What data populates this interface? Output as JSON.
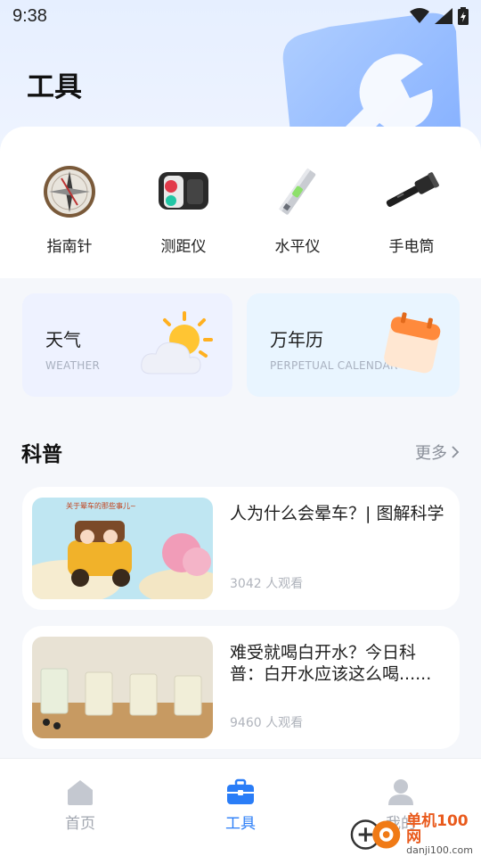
{
  "status_bar": {
    "time": "9:38"
  },
  "page": {
    "title": "工具"
  },
  "tools": [
    {
      "label": "指南针",
      "icon": "compass-icon"
    },
    {
      "label": "测距仪",
      "icon": "rangefinder-icon"
    },
    {
      "label": "水平仪",
      "icon": "level-icon"
    },
    {
      "label": "手电筒",
      "icon": "flashlight-icon"
    }
  ],
  "cards": {
    "weather": {
      "title": "天气",
      "subtitle": "WEATHER",
      "icon": "weather-cloud-sun-icon"
    },
    "calendar": {
      "title": "万年历",
      "subtitle": "PERPETUAL CALENDAR",
      "icon": "calendar-icon"
    }
  },
  "science": {
    "title": "科普",
    "more": "更多",
    "articles": [
      {
        "title": "人为什么会晕车？| 图解科学",
        "views": "3042 人观看",
        "thumb_caption": "关于晕车的那些事儿~"
      },
      {
        "title": "难受就喝白开水？今日科普：白开水应该这么喝......",
        "views": "9460 人观看"
      }
    ]
  },
  "tabbar": {
    "items": [
      {
        "label": "首页",
        "icon": "home-icon",
        "active": false
      },
      {
        "label": "工具",
        "icon": "toolbox-icon",
        "active": true
      },
      {
        "label": "我的",
        "icon": "person-icon",
        "active": false
      }
    ]
  },
  "watermark": {
    "brand": "单机100网",
    "url": "danji100.com"
  },
  "colors": {
    "accent": "#2a7df7",
    "muted": "#a2a7b0"
  }
}
